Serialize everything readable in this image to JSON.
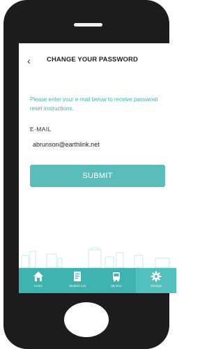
{
  "header": {
    "back_label": "‹",
    "title": "CHANGE YOUR PASSWORD"
  },
  "form": {
    "instructions": "Please enter your e-mail below to receive password reset instructions.",
    "email_label": "E-MAIL",
    "email_value": "abrunson@earthlink.net",
    "submit_label": "SUBMIT"
  },
  "tabs": [
    {
      "label": "Home",
      "icon": "home-icon"
    },
    {
      "label": "Student List",
      "icon": "document-icon"
    },
    {
      "label": "My Bus",
      "icon": "bus-icon"
    },
    {
      "label": "Settings",
      "icon": "gear-icon"
    }
  ],
  "active_tab": "Settings",
  "colors": {
    "accent": "#3fb3b0",
    "button": "#5bbdb9",
    "phone": "#1c1c1c"
  }
}
